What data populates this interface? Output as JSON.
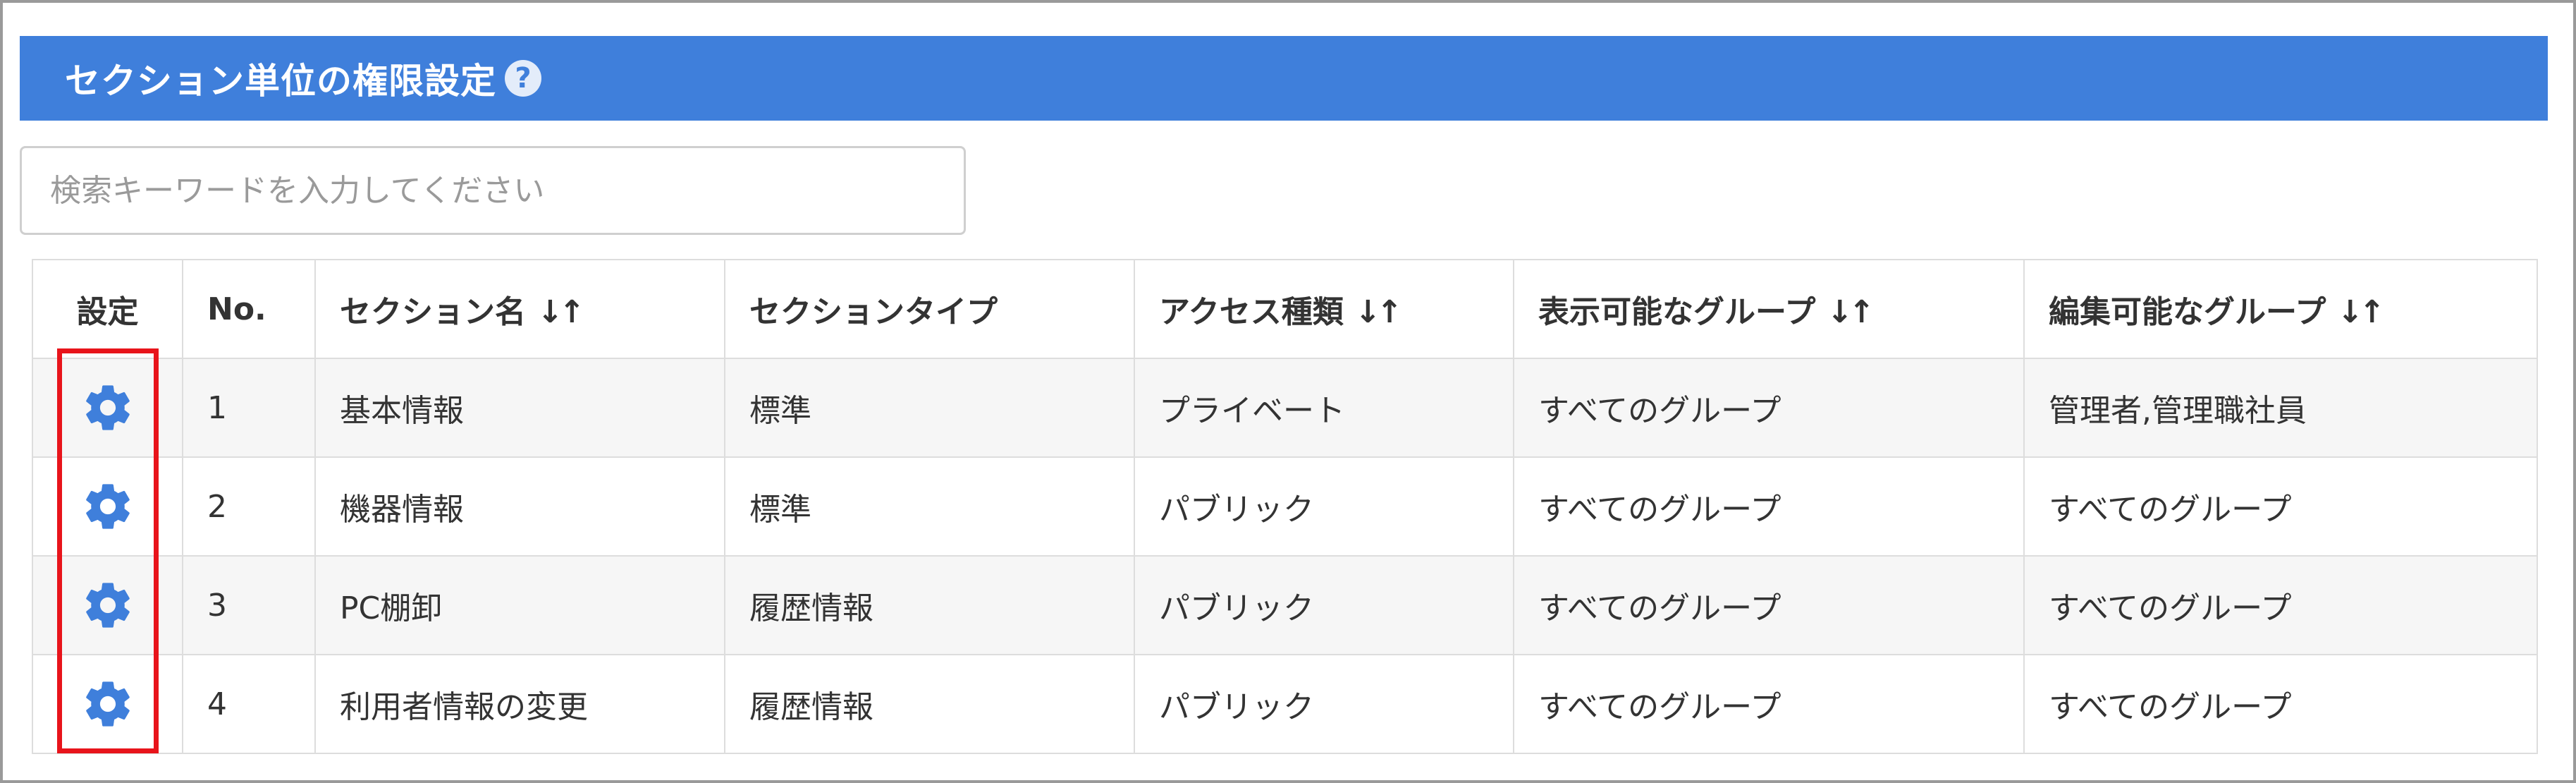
{
  "header": {
    "title": "セクション単位の権限設定",
    "help_symbol": "?"
  },
  "search": {
    "placeholder": "検索キーワードを入力してください",
    "value": ""
  },
  "table": {
    "columns": [
      {
        "key": "settings",
        "label": "設定",
        "sortable": false
      },
      {
        "key": "no",
        "label": "No.",
        "sortable": false
      },
      {
        "key": "section_name",
        "label": "セクション名",
        "sortable": true
      },
      {
        "key": "section_type",
        "label": "セクションタイプ",
        "sortable": false
      },
      {
        "key": "access_type",
        "label": "アクセス種類",
        "sortable": true
      },
      {
        "key": "view_groups",
        "label": "表示可能なグループ",
        "sortable": true
      },
      {
        "key": "edit_groups",
        "label": "編集可能なグループ",
        "sortable": true
      }
    ],
    "sort_symbol": "↓↑",
    "rows": [
      {
        "no": "1",
        "section_name": "基本情報",
        "section_type": "標準",
        "access_type": "プライベート",
        "view_groups": "すべてのグループ",
        "edit_groups": "管理者,管理職社員"
      },
      {
        "no": "2",
        "section_name": "機器情報",
        "section_type": "標準",
        "access_type": "パブリック",
        "view_groups": "すべてのグループ",
        "edit_groups": "すべてのグループ"
      },
      {
        "no": "3",
        "section_name": "PC棚卸",
        "section_type": "履歴情報",
        "access_type": "パブリック",
        "view_groups": "すべてのグループ",
        "edit_groups": "すべてのグループ"
      },
      {
        "no": "4",
        "section_name": "利用者情報の変更",
        "section_type": "履歴情報",
        "access_type": "パブリック",
        "view_groups": "すべてのグループ",
        "edit_groups": "すべてのグループ"
      }
    ]
  },
  "colors": {
    "header_bg": "#3f7fdb",
    "gear": "#3f7fdb",
    "highlight": "#e8141b"
  },
  "icons": {
    "settings": "gear-icon",
    "help": "help-icon",
    "sort": "sort-icon"
  }
}
